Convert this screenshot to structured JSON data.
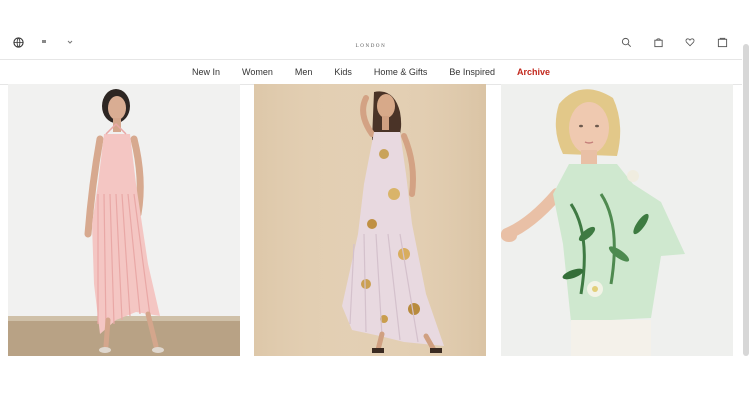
{
  "header": {
    "logo_sub": "LONDON",
    "icons": {
      "left": [
        "globe-icon",
        "location-pin-icon",
        "chevron-down-icon"
      ],
      "right": [
        "search-icon",
        "bag-icon",
        "heart-icon",
        "account-icon"
      ]
    }
  },
  "nav": {
    "items": [
      "New In",
      "Women",
      "Men",
      "Kids",
      "Home & Gifts",
      "Be Inspired",
      "Archive"
    ],
    "highlight_color": "#c2281d"
  },
  "products": [
    {
      "image": "model in pink pleated halter midi dress"
    },
    {
      "image": "model in lilac floral pleated halter maxi dress"
    },
    {
      "image": "model in mint green floral print sleeveless top"
    }
  ],
  "colors": {
    "card1_bg": "#f1f1f0",
    "card2_bg": "#e3cfb3",
    "card3_bg": "#eff0ee"
  }
}
